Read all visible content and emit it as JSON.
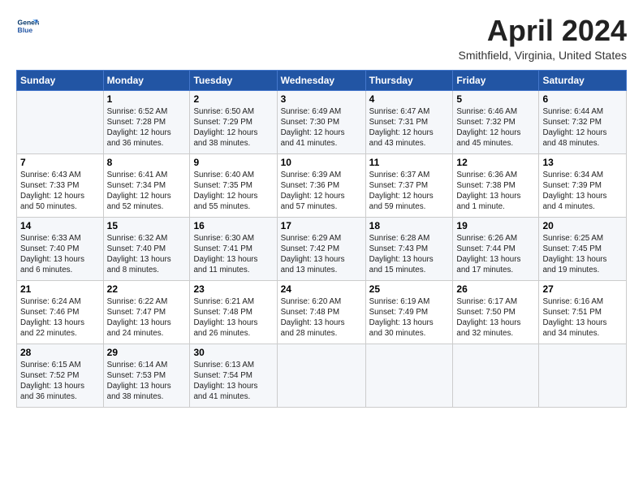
{
  "header": {
    "logo_line1": "General",
    "logo_line2": "Blue",
    "title": "April 2024",
    "location": "Smithfield, Virginia, United States"
  },
  "columns": [
    "Sunday",
    "Monday",
    "Tuesday",
    "Wednesday",
    "Thursday",
    "Friday",
    "Saturday"
  ],
  "weeks": [
    [
      {
        "num": "",
        "info": ""
      },
      {
        "num": "1",
        "info": "Sunrise: 6:52 AM\nSunset: 7:28 PM\nDaylight: 12 hours\nand 36 minutes."
      },
      {
        "num": "2",
        "info": "Sunrise: 6:50 AM\nSunset: 7:29 PM\nDaylight: 12 hours\nand 38 minutes."
      },
      {
        "num": "3",
        "info": "Sunrise: 6:49 AM\nSunset: 7:30 PM\nDaylight: 12 hours\nand 41 minutes."
      },
      {
        "num": "4",
        "info": "Sunrise: 6:47 AM\nSunset: 7:31 PM\nDaylight: 12 hours\nand 43 minutes."
      },
      {
        "num": "5",
        "info": "Sunrise: 6:46 AM\nSunset: 7:32 PM\nDaylight: 12 hours\nand 45 minutes."
      },
      {
        "num": "6",
        "info": "Sunrise: 6:44 AM\nSunset: 7:32 PM\nDaylight: 12 hours\nand 48 minutes."
      }
    ],
    [
      {
        "num": "7",
        "info": "Sunrise: 6:43 AM\nSunset: 7:33 PM\nDaylight: 12 hours\nand 50 minutes."
      },
      {
        "num": "8",
        "info": "Sunrise: 6:41 AM\nSunset: 7:34 PM\nDaylight: 12 hours\nand 52 minutes."
      },
      {
        "num": "9",
        "info": "Sunrise: 6:40 AM\nSunset: 7:35 PM\nDaylight: 12 hours\nand 55 minutes."
      },
      {
        "num": "10",
        "info": "Sunrise: 6:39 AM\nSunset: 7:36 PM\nDaylight: 12 hours\nand 57 minutes."
      },
      {
        "num": "11",
        "info": "Sunrise: 6:37 AM\nSunset: 7:37 PM\nDaylight: 12 hours\nand 59 minutes."
      },
      {
        "num": "12",
        "info": "Sunrise: 6:36 AM\nSunset: 7:38 PM\nDaylight: 13 hours\nand 1 minute."
      },
      {
        "num": "13",
        "info": "Sunrise: 6:34 AM\nSunset: 7:39 PM\nDaylight: 13 hours\nand 4 minutes."
      }
    ],
    [
      {
        "num": "14",
        "info": "Sunrise: 6:33 AM\nSunset: 7:40 PM\nDaylight: 13 hours\nand 6 minutes."
      },
      {
        "num": "15",
        "info": "Sunrise: 6:32 AM\nSunset: 7:40 PM\nDaylight: 13 hours\nand 8 minutes."
      },
      {
        "num": "16",
        "info": "Sunrise: 6:30 AM\nSunset: 7:41 PM\nDaylight: 13 hours\nand 11 minutes."
      },
      {
        "num": "17",
        "info": "Sunrise: 6:29 AM\nSunset: 7:42 PM\nDaylight: 13 hours\nand 13 minutes."
      },
      {
        "num": "18",
        "info": "Sunrise: 6:28 AM\nSunset: 7:43 PM\nDaylight: 13 hours\nand 15 minutes."
      },
      {
        "num": "19",
        "info": "Sunrise: 6:26 AM\nSunset: 7:44 PM\nDaylight: 13 hours\nand 17 minutes."
      },
      {
        "num": "20",
        "info": "Sunrise: 6:25 AM\nSunset: 7:45 PM\nDaylight: 13 hours\nand 19 minutes."
      }
    ],
    [
      {
        "num": "21",
        "info": "Sunrise: 6:24 AM\nSunset: 7:46 PM\nDaylight: 13 hours\nand 22 minutes."
      },
      {
        "num": "22",
        "info": "Sunrise: 6:22 AM\nSunset: 7:47 PM\nDaylight: 13 hours\nand 24 minutes."
      },
      {
        "num": "23",
        "info": "Sunrise: 6:21 AM\nSunset: 7:48 PM\nDaylight: 13 hours\nand 26 minutes."
      },
      {
        "num": "24",
        "info": "Sunrise: 6:20 AM\nSunset: 7:48 PM\nDaylight: 13 hours\nand 28 minutes."
      },
      {
        "num": "25",
        "info": "Sunrise: 6:19 AM\nSunset: 7:49 PM\nDaylight: 13 hours\nand 30 minutes."
      },
      {
        "num": "26",
        "info": "Sunrise: 6:17 AM\nSunset: 7:50 PM\nDaylight: 13 hours\nand 32 minutes."
      },
      {
        "num": "27",
        "info": "Sunrise: 6:16 AM\nSunset: 7:51 PM\nDaylight: 13 hours\nand 34 minutes."
      }
    ],
    [
      {
        "num": "28",
        "info": "Sunrise: 6:15 AM\nSunset: 7:52 PM\nDaylight: 13 hours\nand 36 minutes."
      },
      {
        "num": "29",
        "info": "Sunrise: 6:14 AM\nSunset: 7:53 PM\nDaylight: 13 hours\nand 38 minutes."
      },
      {
        "num": "30",
        "info": "Sunrise: 6:13 AM\nSunset: 7:54 PM\nDaylight: 13 hours\nand 41 minutes."
      },
      {
        "num": "",
        "info": ""
      },
      {
        "num": "",
        "info": ""
      },
      {
        "num": "",
        "info": ""
      },
      {
        "num": "",
        "info": ""
      }
    ]
  ]
}
